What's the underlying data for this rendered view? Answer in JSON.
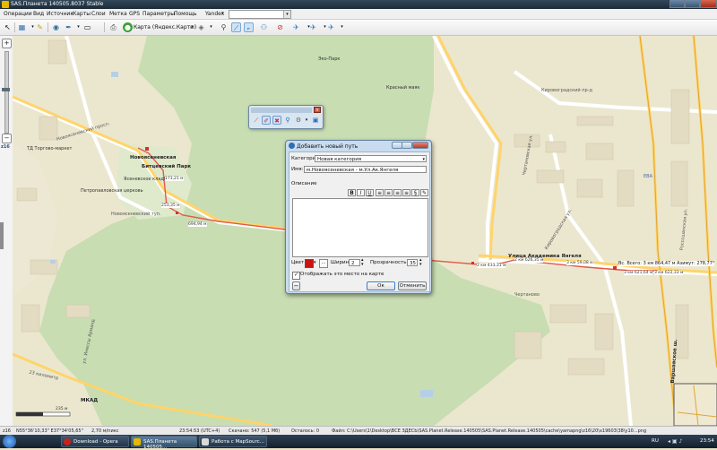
{
  "window": {
    "title": "SAS.Планета 140505.8037 Stable"
  },
  "menu": {
    "items": [
      "Операции",
      "Вид",
      "Источник",
      "Карты",
      "Слои",
      "Метка",
      "GPS",
      "Параметры",
      "Помощь"
    ],
    "search_provider": "Yandex",
    "search_value": ""
  },
  "toolbar": {
    "map_name": "Карта (Яндекс.Карты)"
  },
  "left_panel": {
    "zoom_level": "z16"
  },
  "map_labels": {
    "labels": [
      {
        "text": "Эко-Парк",
        "cls": "green"
      },
      {
        "text": "Красный маяк",
        "cls": ""
      },
      {
        "text": "Кировоградский пр-д",
        "cls": "street"
      },
      {
        "text": "Битцевский Парк",
        "cls": "road"
      },
      {
        "text": "Новоясеневская",
        "cls": "road"
      },
      {
        "text": "Новоясеневский просп.",
        "cls": "street"
      },
      {
        "text": "Новоясеневский туп.",
        "cls": "street"
      },
      {
        "text": "ТД Торгово-маркет",
        "cls": ""
      },
      {
        "text": "Петропавловская церковь",
        "cls": ""
      },
      {
        "text": "Ясеневское кладбище",
        "cls": ""
      },
      {
        "text": "Чертановская ул.",
        "cls": "street"
      },
      {
        "text": "Кировоградская ул.",
        "cls": "street"
      },
      {
        "text": "Россошанская ул.",
        "cls": "street"
      },
      {
        "text": "Варшавское ш.",
        "cls": "road"
      },
      {
        "text": "Улица Академика Янгеля",
        "cls": "road"
      },
      {
        "text": "МКАД",
        "cls": "road"
      },
      {
        "text": "23 километр",
        "cls": "street"
      },
      {
        "text": "ул. Инессы Арманд",
        "cls": "street"
      },
      {
        "text": "ЕВА",
        "cls": "blue"
      },
      {
        "text": "Чертаново",
        "cls": "green"
      }
    ],
    "route_marks": [
      "173,21 м",
      "253,35 м",
      "694,94 м",
      "2 км 433,31 м",
      "2 км 626,35 м",
      "3 км 59,08 м",
      "3 км 621,64 м",
      "3 км 622,33 м"
    ],
    "total_label": "Вс. Всего: 3 км 864,47 м Азимут: 278,77°"
  },
  "float_toolbar": {
    "label": "Панель"
  },
  "dialog": {
    "title": "Добавить новый путь",
    "category_label": "Категория:",
    "category_value": "Новая категория",
    "name_label": "Имя:",
    "name_value": "м.Новоясеневская - м.Ул.Ак.Янгеля",
    "description_label": "Описание",
    "color_label": "Цвет",
    "color_value": "#cc1111",
    "width_label": "Ширина",
    "width_value": "2",
    "transparency_label": "Прозрачность %",
    "transparency_value": "35",
    "show_label": "Отображать это место на карте",
    "ok_label": "Ок",
    "cancel_label": "Отменить",
    "format_buttons": [
      "B",
      "I",
      "U",
      "≡",
      "≡",
      "≡",
      "≡",
      "§",
      "✎"
    ]
  },
  "status": {
    "zoom": "z16",
    "coords": "N55°36'10,33\" E37°34'05,65\"",
    "scale": "2,70 м/пикс",
    "scale_bar": "235 м",
    "time": "23:54:53 (UTC+4)",
    "downloaded": "Скачано: 547 (5,1 Мб)",
    "remaining": "Осталось: 0",
    "file": "Файл: C:\\Users\\1\\Desktop\\ВСЕ ЗДЕСЬ\\SAS.Planet.Release.140505\\SAS.Planet.Release.140505\\cache\\yamapng\\z16\\20\\x19603\\38\\y10...png"
  },
  "taskbar": {
    "items": [
      "Download - Opera",
      "SAS.Планета 140505...",
      "Работа с MapSourc..."
    ],
    "lang": "RU",
    "clock": "23:54"
  },
  "colors": {
    "route": "#e25a4a",
    "forest": "#c6ddb1",
    "city": "#f2eedb",
    "road": "#ffd46a"
  }
}
